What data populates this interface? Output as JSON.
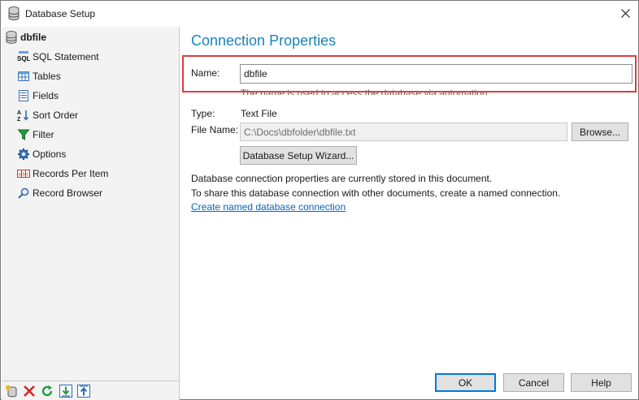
{
  "window": {
    "title": "Database Setup"
  },
  "tree": {
    "root": "dbfile",
    "items": [
      {
        "label": "SQL Statement",
        "icon": "sql-icon"
      },
      {
        "label": "Tables",
        "icon": "table-icon"
      },
      {
        "label": "Fields",
        "icon": "fields-icon"
      },
      {
        "label": "Sort Order",
        "icon": "sort-az-icon"
      },
      {
        "label": "Filter",
        "icon": "funnel-icon"
      },
      {
        "label": "Options",
        "icon": "gear-icon"
      },
      {
        "label": "Records Per Item",
        "icon": "records-icon"
      },
      {
        "label": "Record Browser",
        "icon": "magnifier-icon"
      }
    ]
  },
  "toolbar": {
    "buttons": [
      "add-database-icon",
      "delete-icon",
      "refresh-icon",
      "move-down-icon",
      "move-up-icon"
    ]
  },
  "content": {
    "heading": "Connection Properties",
    "name_label": "Name:",
    "name_value": "dbfile",
    "name_hint": "The name is used to access the database via automation.",
    "type_label": "Type:",
    "type_value": "Text File",
    "file_label": "File Name:",
    "file_value": "C:\\Docs\\dbfolder\\dbfile.txt",
    "browse_label": "Browse...",
    "wizard_label": "Database Setup Wizard...",
    "info_line1": "Database connection properties are currently stored in this document.",
    "info_line2": "To share this database connection with other documents, create a named connection.",
    "link_text": "Create named database connection"
  },
  "footer": {
    "ok_label": "OK",
    "cancel_label": "Cancel",
    "help_label": "Help"
  },
  "colors": {
    "heading": "#1b83b8",
    "highlight": "#e03c3c",
    "link": "#0066cc",
    "default_button_border": "#0078d7"
  }
}
